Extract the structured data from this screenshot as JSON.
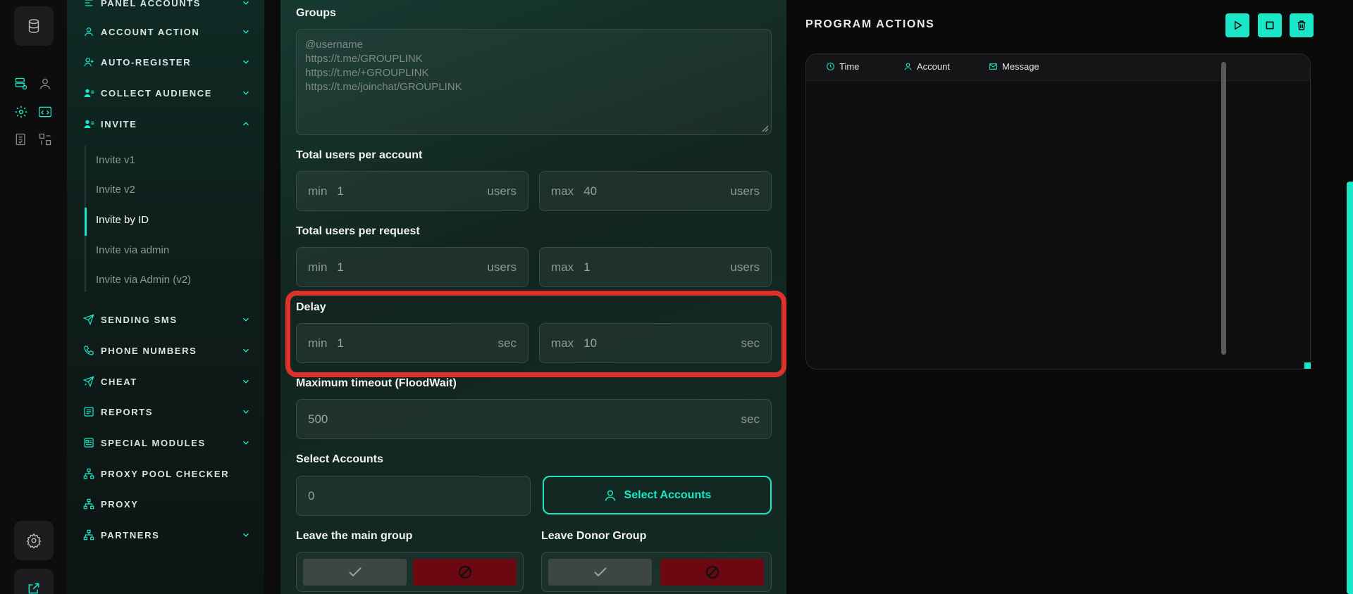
{
  "colors": {
    "accent": "#19e7c8",
    "danger": "#6b0811",
    "highlight": "#e0302b"
  },
  "sidebar": {
    "items": [
      {
        "label": "Panel Accounts",
        "icon": "users-icon",
        "expanded": false
      },
      {
        "label": "Account Action",
        "icon": "user-icon",
        "expanded": false
      },
      {
        "label": "Auto-Register",
        "icon": "user-plus-icon",
        "expanded": false
      },
      {
        "label": "Collect Audience",
        "icon": "user-list-icon",
        "expanded": false
      },
      {
        "label": "Invite",
        "icon": "user-list-icon",
        "expanded": true
      },
      {
        "label": "Sending SMS",
        "icon": "send-icon",
        "expanded": false
      },
      {
        "label": "Phone Numbers",
        "icon": "phone-icon",
        "expanded": false
      },
      {
        "label": "Cheat",
        "icon": "send-alt-icon",
        "expanded": false
      },
      {
        "label": "Reports",
        "icon": "report-icon",
        "expanded": false
      },
      {
        "label": "Special Modules",
        "icon": "modules-icon",
        "expanded": false
      },
      {
        "label": "Proxy Pool Checker",
        "icon": "network-icon"
      },
      {
        "label": "Proxy",
        "icon": "network-icon"
      },
      {
        "label": "Partners",
        "icon": "network-icon",
        "expanded": false
      }
    ],
    "invite_sub": [
      "Invite v1",
      "Invite v2",
      "Invite by ID",
      "Invite via admin",
      "Invite via Admin (v2)"
    ],
    "active_sub": "Invite by ID"
  },
  "form": {
    "groups": {
      "label": "Groups",
      "placeholder_lines": [
        "@username",
        "https://t.me/GROUPLINK",
        "https://t.me/+GROUPLINK",
        "https://t.me/joinchat/GROUPLINK"
      ]
    },
    "users_per_account": {
      "label": "Total users per account",
      "min_pre": "min",
      "min": "1",
      "max_pre": "max",
      "max": "40",
      "unit": "users"
    },
    "users_per_request": {
      "label": "Total users per request",
      "min_pre": "min",
      "min": "1",
      "max_pre": "max",
      "max": "1",
      "unit": "users"
    },
    "delay": {
      "label": "Delay",
      "min_pre": "min",
      "min": "1",
      "max_pre": "max",
      "max": "10",
      "unit": "sec"
    },
    "timeout": {
      "label": "Maximum timeout (FloodWait)",
      "value": "500",
      "unit": "sec"
    },
    "accounts": {
      "label": "Select Accounts",
      "value": "0",
      "button": "Select Accounts"
    },
    "leave_main": {
      "label": "Leave the main group"
    },
    "leave_donor": {
      "label": "Leave Donor Group"
    }
  },
  "program": {
    "title": "PROGRAM ACTIONS",
    "columns": [
      "Time",
      "Account",
      "Message"
    ]
  }
}
